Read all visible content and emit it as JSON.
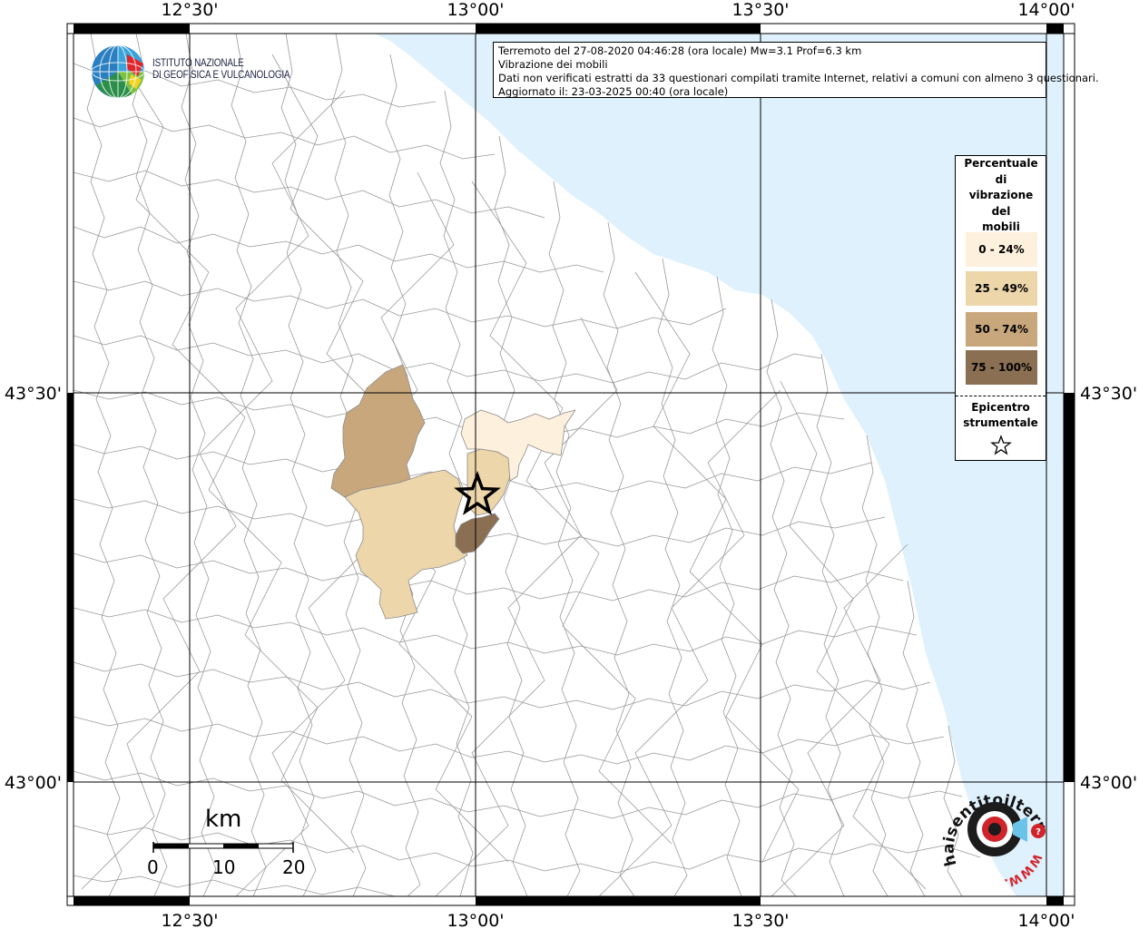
{
  "map": {
    "lon_ticks": [
      "12°30'",
      "13°00'",
      "13°30'",
      "14°00'"
    ],
    "lat_ticks": [
      "43°30'",
      "43°00'"
    ],
    "colors": {
      "sea": "#dff1fc",
      "land": "#ffffff",
      "borders": "#9a9a9a",
      "class0": "#fdf0dc",
      "class1": "#ecd6aa",
      "class2": "#c9a77c",
      "class3": "#8b6f53"
    },
    "epicenter_icon": "star-icon"
  },
  "info": {
    "line1": "Terremoto del 27-08-2020 04:46:28 (ora locale) Mw=3.1 Prof=6.3 km",
    "line2": "Vibrazione dei mobili",
    "line3": "Dati non verificati estratti da 33 questionari compilati tramite Internet, relativi a comuni con almeno 3 questionari.",
    "line4": "Aggiornato il: 23-03-2025 00:40 (ora locale)"
  },
  "legend": {
    "title_lines": [
      "Percentuale",
      "di",
      "vibrazione",
      "del",
      "mobili"
    ],
    "classes": [
      {
        "label": "0 - 24%",
        "color": "#fdf0dc"
      },
      {
        "label": "25 - 49%",
        "color": "#ecd6aa"
      },
      {
        "label": "50 - 74%",
        "color": "#c9a77c"
      },
      {
        "label": "75 - 100%",
        "color": "#8b6f53"
      }
    ],
    "epicenter_lines": [
      "Epicentro",
      "strumentale"
    ]
  },
  "scale": {
    "unit": "km",
    "ticks": [
      "0",
      "10",
      "20"
    ]
  },
  "logos": {
    "ingv_line1": "ISTITUTO NAZIONALE",
    "ingv_line2": "DI GEOFISICA E VULCANOLOGIA",
    "hst_text": "haisentitoilterremoto.it",
    "hst_url": "WWW."
  }
}
